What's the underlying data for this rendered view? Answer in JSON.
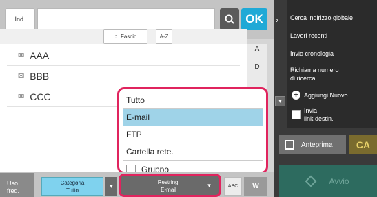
{
  "header": {
    "address_btn": "Ind.",
    "ok_label": "OK"
  },
  "sort": {
    "fascic_label": "Fascic",
    "name_sort_label": "A-Z"
  },
  "list": {
    "items": [
      {
        "label": "AAA"
      },
      {
        "label": "BBB"
      },
      {
        "label": "CCC"
      }
    ]
  },
  "index": {
    "letters": [
      "A",
      "D"
    ]
  },
  "dropdown": {
    "options": [
      {
        "label": "Tutto",
        "selected": false
      },
      {
        "label": "E-mail",
        "selected": true
      },
      {
        "label": "FTP",
        "selected": false
      },
      {
        "label": "Cartella rete.",
        "selected": false
      },
      {
        "label": "Gruppo",
        "selected": false,
        "checkbox": true
      }
    ]
  },
  "bottom": {
    "freq_line1": "Uso",
    "freq_line2": "freq.",
    "category_title": "Categoria",
    "category_value": "Tutto",
    "filter_title": "Restringi",
    "filter_value": "E-mail",
    "abc_label": "ABC",
    "w_label": "W"
  },
  "right_panel": {
    "search_global": "Cerca indirizzo globale",
    "recent_jobs": "Lavori recenti",
    "history": "Invio cronologia",
    "recall_line1": "Richiama numero",
    "recall_line2": "di ricerca",
    "add_new": "Aggiungi Nuovo",
    "send_link_line1": "Invia",
    "send_link_line2": "link destin.",
    "preview": "Anteprima",
    "ca": "CA",
    "start": "Avvio"
  },
  "colors": {
    "accent_blue": "#1fa9d6",
    "highlight_red": "#e0245e",
    "selected_bg": "#9fd3e8",
    "start_green": "#2d6b5f"
  }
}
